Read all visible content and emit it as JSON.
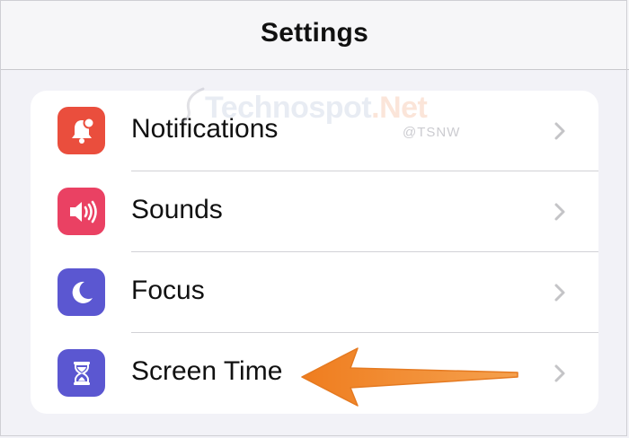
{
  "navbar": {
    "title": "Settings"
  },
  "watermark": {
    "brand": "Technospot",
    "brand_suffix": ".Net",
    "handle": "@TSNW"
  },
  "rows": [
    {
      "label": "Notifications",
      "icon": "bell-badge-icon",
      "color": "#ea4e3d"
    },
    {
      "label": "Sounds",
      "icon": "speaker-icon",
      "color": "#ea4163"
    },
    {
      "label": "Focus",
      "icon": "moon-icon",
      "color": "#5b57d1"
    },
    {
      "label": "Screen Time",
      "icon": "hourglass-icon",
      "color": "#5b57d1"
    }
  ],
  "annotation": {
    "arrow_color": "#f08a2c",
    "points_to": "Screen Time"
  }
}
